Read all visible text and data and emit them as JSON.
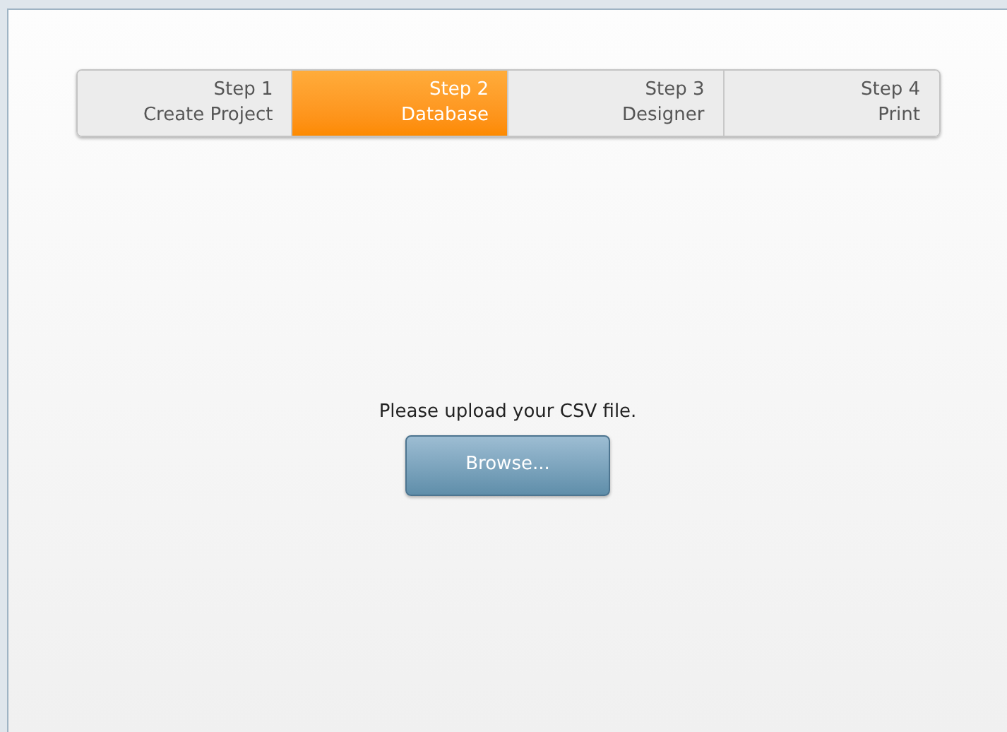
{
  "steps": [
    {
      "number": "Step 1",
      "label": "Create Project",
      "selected": false
    },
    {
      "number": "Step 2",
      "label": "Database",
      "selected": true
    },
    {
      "number": "Step 3",
      "label": "Designer",
      "selected": false
    },
    {
      "number": "Step 4",
      "label": "Print",
      "selected": false
    }
  ],
  "message": "Please upload your CSV file.",
  "browse_button": "Browse..."
}
